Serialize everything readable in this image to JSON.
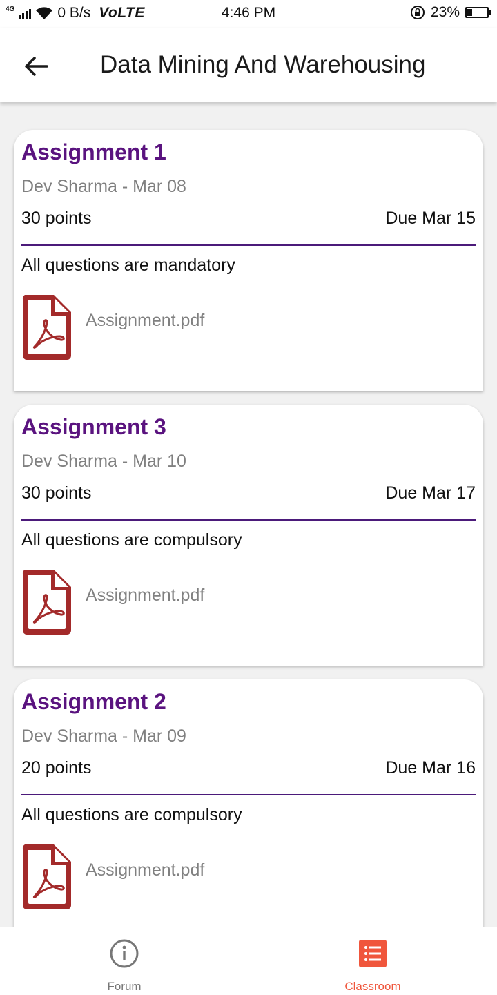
{
  "status_bar": {
    "network": "4G",
    "data_rate": "0 B/s",
    "volte": "VoLTE",
    "time": "4:46 PM",
    "battery_percent": "23%",
    "battery_level": 0.23
  },
  "app_bar": {
    "title": "Data Mining And Warehousing"
  },
  "assignments": [
    {
      "title": "Assignment 1",
      "meta": "Dev Sharma - Mar 08",
      "points": "30 points",
      "due": "Due Mar 15",
      "description": "All questions are mandatory",
      "attachment": "Assignment.pdf"
    },
    {
      "title": "Assignment 3",
      "meta": "Dev Sharma - Mar 10",
      "points": "30 points",
      "due": "Due Mar 17",
      "description": "All questions are compulsory",
      "attachment": "Assignment.pdf"
    },
    {
      "title": "Assignment 2",
      "meta": "Dev Sharma - Mar 09",
      "points": "20 points",
      "due": "Due Mar 16",
      "description": "All questions are compulsory",
      "attachment": "Assignment.pdf"
    }
  ],
  "bottom_nav": {
    "items": [
      {
        "label": "Forum",
        "icon": "info-circle-icon",
        "active": false
      },
      {
        "label": "Classroom",
        "icon": "list-icon",
        "active": true
      }
    ]
  },
  "colors": {
    "title_purple": "#5a137f",
    "divider_purple": "#4b1a7a",
    "pdf_red": "#a32a2a",
    "accent_orange": "#f0563c"
  }
}
